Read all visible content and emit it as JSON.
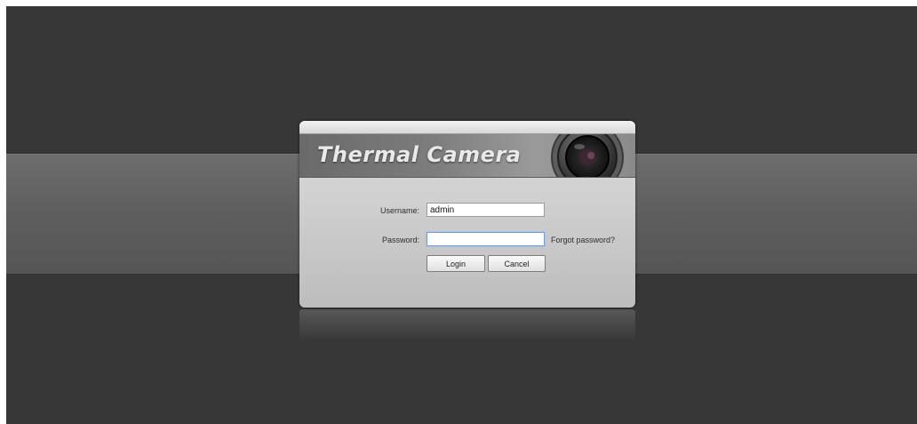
{
  "login": {
    "product_title": "Thermal Camera",
    "username_label": "Username:",
    "username_value": "admin",
    "password_label": "Password:",
    "password_value": "",
    "forgot_link": "Forgot password?",
    "login_button": "Login",
    "cancel_button": "Cancel"
  },
  "icons": {
    "lens": "camera-lens-icon"
  },
  "colors": {
    "background": "#373737",
    "band": "#5e5e5e",
    "focus_border": "#6f9ed6"
  }
}
